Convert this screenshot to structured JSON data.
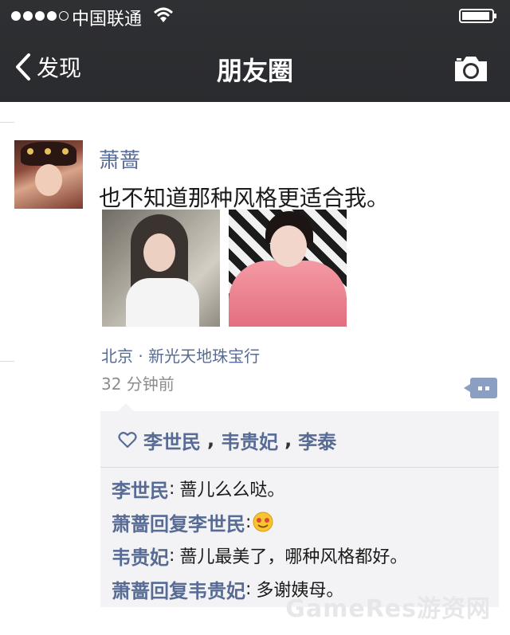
{
  "status_bar": {
    "carrier": "中国联通",
    "signal_filled": 4,
    "signal_total": 5
  },
  "nav": {
    "back_label": "发现",
    "title": "朋友圈"
  },
  "post": {
    "author": "萧蔷",
    "text": "也不知道那种风格更适合我。",
    "location": "北京 · 新光天地珠宝行",
    "time": "32 分钟前",
    "likes": [
      "李世民",
      "韦贵妃",
      "李泰"
    ],
    "like_separator": ",",
    "comments": [
      {
        "from": "李世民",
        "reply_word": "",
        "to": "",
        "colon": ":",
        "text": "蔷儿么么哒。",
        "emoji": ""
      },
      {
        "from": "萧蔷",
        "reply_word": "回复",
        "to": "李世民",
        "colon": ":",
        "text": "",
        "emoji": "blushing-smile-emoji"
      },
      {
        "from": "韦贵妃",
        "reply_word": "",
        "to": "",
        "colon": ":",
        "text": "蔷儿最美了，哪种风格都好。",
        "emoji": ""
      },
      {
        "from": "萧蔷",
        "reply_word": "回复",
        "to": "韦贵妃",
        "colon": ":",
        "text": "多谢姨母。",
        "emoji": ""
      }
    ]
  },
  "watermark": "GameRes游资网",
  "colors": {
    "nav_bg": "#2f3033",
    "link_blue": "#576b95",
    "comment_box": "#f3f3f5"
  }
}
